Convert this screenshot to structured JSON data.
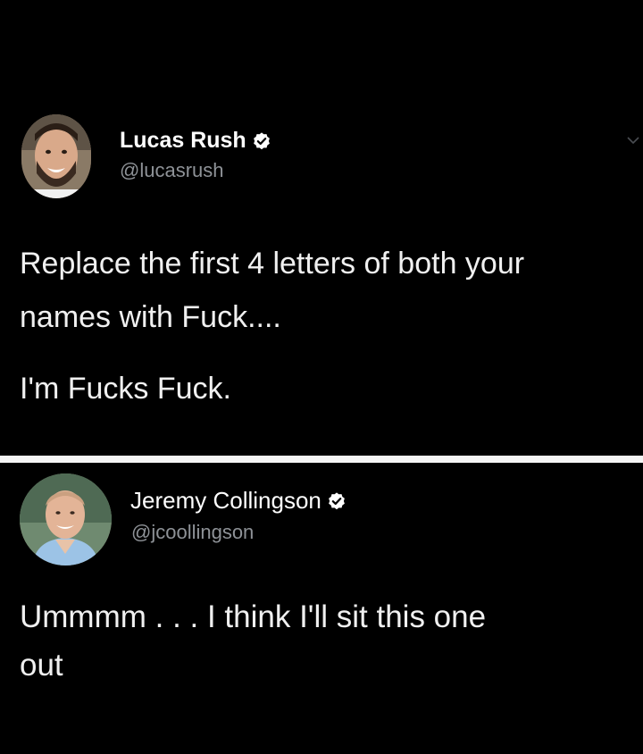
{
  "colors": {
    "background": "#000000",
    "divider": "#f4f4f4",
    "text": "#f0f0f0",
    "handle": "#8e9297",
    "verified_badge": "#ffffff"
  },
  "tweets": [
    {
      "author": {
        "display_name": "Lucas Rush",
        "handle": "@lucasrush",
        "verified": true,
        "avatar_icon": "avatar-bearded-man"
      },
      "menu_icon": "chevron-down-icon",
      "body_lines": [
        "Replace the first 4 letters of both your",
        "names with Fuck....",
        "I'm Fucks Fuck."
      ]
    },
    {
      "author": {
        "display_name": "Jeremy Collingson",
        "handle": "@jcoollingson",
        "verified": true,
        "avatar_icon": "avatar-smiling-man"
      },
      "body_lines": [
        "Ummmm . . . I think I'll sit this one",
        "out"
      ]
    }
  ]
}
